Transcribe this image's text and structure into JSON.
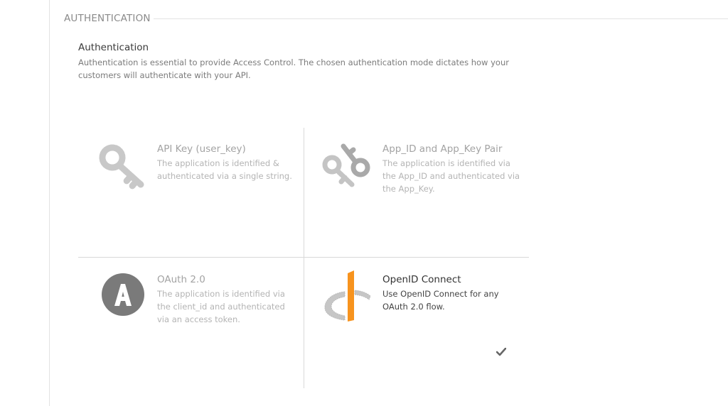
{
  "section": {
    "title": "AUTHENTICATION"
  },
  "intro": {
    "heading": "Authentication",
    "text": "Authentication is essential to provide Access Control. The chosen authentication mode dictates how your customers will authenticate with your API."
  },
  "options": [
    {
      "id": "api-key",
      "title": "API Key (user_key)",
      "description": "The application is identified & authenticated via a single string.",
      "icon": "key-icon",
      "selected": false
    },
    {
      "id": "app-id-key",
      "title": "App_ID and App_Key Pair",
      "description": "The application is identified via the App_ID and authenticated via the App_Key.",
      "icon": "key-pair-icon",
      "selected": false
    },
    {
      "id": "oauth2",
      "title": "OAuth 2.0",
      "description": "The application is identified via the client_id and authenticated via an access token.",
      "icon": "oauth-icon",
      "selected": false
    },
    {
      "id": "openid",
      "title": "OpenID Connect",
      "description": "Use OpenID Connect for any OAuth 2.0 flow.",
      "icon": "openid-icon",
      "selected": true
    }
  ],
  "colors": {
    "accent": "#f7931e",
    "icon_gray": "#7a7a7a",
    "grid": "#d9d9d9"
  }
}
